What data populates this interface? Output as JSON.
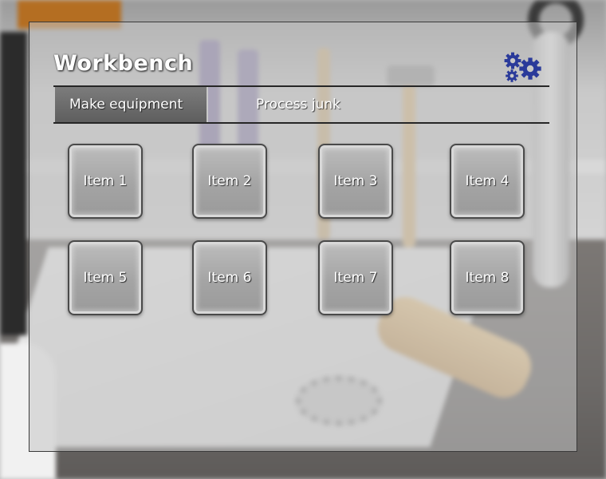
{
  "window": {
    "title": "Workbench"
  },
  "header": {
    "settings_icon": "gears-icon",
    "accent": "#2a3a9a"
  },
  "tabs": [
    {
      "label": "Make equipment",
      "active": true
    },
    {
      "label": "Process junk",
      "active": false
    }
  ],
  "items": [
    {
      "label": "Item 1"
    },
    {
      "label": "Item 2"
    },
    {
      "label": "Item 3"
    },
    {
      "label": "Item 4"
    },
    {
      "label": "Item 5"
    },
    {
      "label": "Item 6"
    },
    {
      "label": "Item 7"
    },
    {
      "label": "Item 8"
    }
  ]
}
